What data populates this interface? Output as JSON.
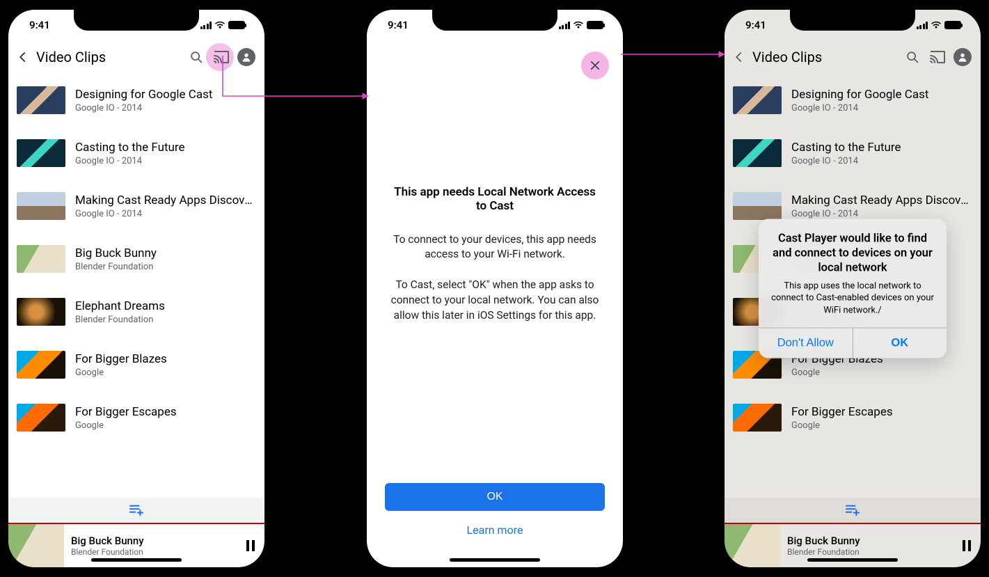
{
  "status": {
    "time": "9:41"
  },
  "header": {
    "title": "Video Clips"
  },
  "videos": [
    {
      "title": "Designing for Google Cast",
      "subtitle": "Google IO - 2014"
    },
    {
      "title": "Casting to the Future",
      "subtitle": "Google IO - 2014"
    },
    {
      "title": "Making Cast Ready Apps Discover…",
      "subtitle": "Google IO - 2014"
    },
    {
      "title": "Big Buck Bunny",
      "subtitle": "Blender Foundation"
    },
    {
      "title": "Elephant Dreams",
      "subtitle": "Blender Foundation"
    },
    {
      "title": "For Bigger Blazes",
      "subtitle": "Google"
    },
    {
      "title": "For Bigger Escapes",
      "subtitle": "Google"
    }
  ],
  "now_playing": {
    "title": "Big Buck Bunny",
    "subtitle": "Blender Foundation"
  },
  "interstitial": {
    "title": "This app needs Local Network Access to Cast",
    "para1": "To connect to your devices, this app needs access to your Wi-Fi network.",
    "para2": "To Cast, select \"OK\" when the app asks to connect to your local network. You can also allow this later in iOS Settings for this app.",
    "ok": "OK",
    "learn_more": "Learn more"
  },
  "dialog": {
    "title": "Cast Player would like to find and connect to devices on your local network",
    "message": "This app uses the local network to connect to Cast-enabled devices on your WiFi network./",
    "dont_allow": "Don't Allow",
    "ok": "OK"
  }
}
